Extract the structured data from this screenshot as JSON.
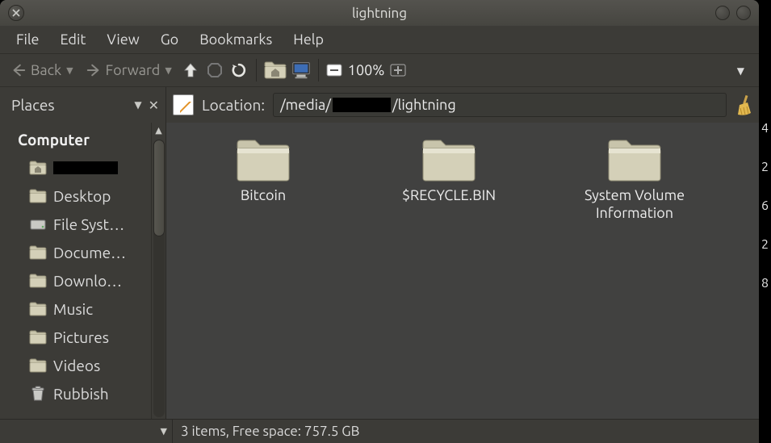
{
  "window": {
    "title": "lightning"
  },
  "menubar": [
    "File",
    "Edit",
    "View",
    "Go",
    "Bookmarks",
    "Help"
  ],
  "toolbar": {
    "back_label": "Back",
    "forward_label": "Forward",
    "zoom_label": "100%"
  },
  "places_panel": {
    "title": "Places"
  },
  "location": {
    "label": "Location:",
    "prefix": "/media/",
    "redacted": true,
    "suffix": "/lightning"
  },
  "sidebar": {
    "heading": "Computer",
    "items": [
      {
        "label": "",
        "icon": "home",
        "redacted": true
      },
      {
        "label": "Desktop",
        "icon": "folder"
      },
      {
        "label": "File Syst…",
        "icon": "drive"
      },
      {
        "label": "Docume…",
        "icon": "folder"
      },
      {
        "label": "Downlo…",
        "icon": "folder"
      },
      {
        "label": "Music",
        "icon": "folder"
      },
      {
        "label": "Pictures",
        "icon": "folder"
      },
      {
        "label": "Videos",
        "icon": "folder"
      },
      {
        "label": "Rubbish",
        "icon": "trash"
      }
    ]
  },
  "folders": [
    {
      "label": "Bitcoin"
    },
    {
      "label": "$RECYCLE.BIN"
    },
    {
      "label": "System Volume Information"
    }
  ],
  "statusbar": {
    "text": "3 items, Free space: 757.5 GB"
  }
}
